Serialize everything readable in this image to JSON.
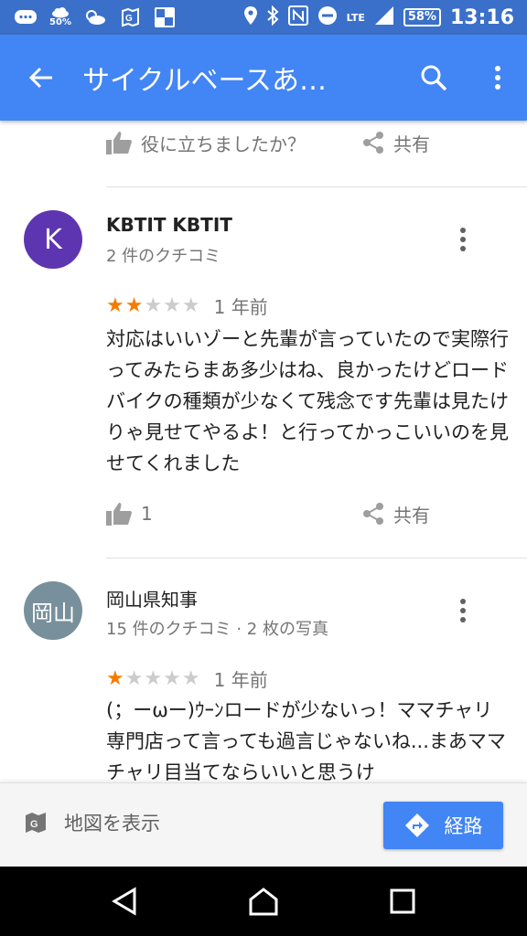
{
  "status_bar": {
    "weather_pct": "50%",
    "network": "LTE",
    "battery": "58%",
    "time": "13:16"
  },
  "app_bar": {
    "title": "サイクルベースあ…"
  },
  "prev_review_actions": {
    "helpful": "役に立ちましたか？",
    "share": "共有"
  },
  "reviews": [
    {
      "avatar_letter": "K",
      "avatar_color": "#5e35b1",
      "name": "KBTIT KBTIT",
      "meta": "2 件のクチコミ",
      "stars": 2,
      "stars_text": "★★★★★",
      "time": "1 年前",
      "text": "対応はいいゾーと先輩が言っていたので実際行ってみたらまあ多少はね、良かったけどロードバイクの種類が少なくて残念です先輩は見たけりゃ見せてやるよ！と行ってかっこいいのを見せてくれました",
      "likes": "1",
      "share": "共有"
    },
    {
      "avatar_letter": "岡山",
      "avatar_color": "#78909c",
      "name": "岡山県知事",
      "meta": "15 件のクチコミ · 2 枚の写真",
      "stars": 1,
      "stars_text": "★★★★★",
      "time": "1 年前",
      "text": "(；ーωー)ｳｰﾝロードが少ないっ！ママチャリ専門店って言っても過言じゃないね...まあママチャリ目当てならいいと思うけ"
    }
  ],
  "bottom_bar": {
    "map_label": "地図を表示",
    "route_label": "経路"
  },
  "colors": {
    "primary": "#4285f4",
    "status_bar": "#3a70c9",
    "star_on": "#f57c00",
    "star_off": "#cccccc"
  }
}
